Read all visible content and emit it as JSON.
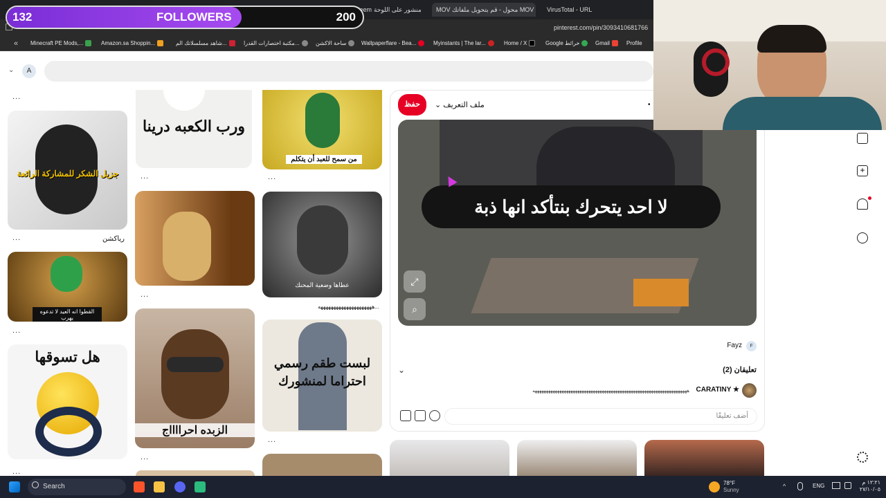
{
  "browser": {
    "tabs": [
      {
        "label": "Meem",
        "active": false
      },
      {
        "label": "منشور على اللوحة",
        "active": false
      },
      {
        "label": "MOV محول - قم بتحويل ملفاتك MOV",
        "active": true
      },
      {
        "label": "VirusTotal - URL",
        "active": false
      }
    ],
    "address": "pinterest.com/pin/3093410681766",
    "bookmarks": [
      {
        "label": "Minecraft PE Mods,...",
        "color": "#3aa04b"
      },
      {
        "label": "Amazon.sa Shoppin...",
        "color": "#f0a020"
      },
      {
        "label": "شاهد مسلسلاتك الم...",
        "color": "#c23"
      },
      {
        "label": "مكتبة اختصارات القدرا...",
        "color": "#888"
      },
      {
        "label": "ساحة الاكشن",
        "color": "#888"
      },
      {
        "label": "Wallpaperflare - Bea...",
        "color": "#e60023"
      },
      {
        "label": "Myinstants | The lar...",
        "color": "#c22"
      },
      {
        "label": "Home / X",
        "color": "#000"
      },
      {
        "label": "Google خرائط",
        "color": "#34a853"
      },
      {
        "label": "Gmail",
        "color": "#ea4335"
      },
      {
        "label": "Profile",
        "color": "#e60023"
      }
    ]
  },
  "overlay": {
    "current": "132",
    "label": "FOLLOWERS",
    "goal": "200",
    "progress": 0.66
  },
  "header": {
    "avatar": "A",
    "search_placeholder": ""
  },
  "pins": {
    "col1": [
      {
        "caption_img": "جزيل الشكر للمشاركة الرائعة",
        "title": "رياكشن"
      },
      {
        "caption_img": "القطوا انه العيد لا تدعوه يهرب",
        "title": ""
      },
      {
        "caption_img": "هل تسوقها",
        "title": ""
      }
    ],
    "col2": [
      {
        "caption_img": "ورب الكعبه درينا",
        "title": ""
      },
      {
        "caption_img": "",
        "title": ""
      },
      {
        "caption_img": "الزبده احرااااج",
        "title": ""
      }
    ],
    "col3": [
      {
        "caption_img": "من سمح للعبد أن يتكلم",
        "title": ""
      },
      {
        "caption_img": "عطاها وضعية المحنك",
        "title": "هههههههههههههههههههههه..."
      },
      {
        "caption_img": "لبست طقم رسمي احتراما لمنشورك",
        "title": ""
      }
    ]
  },
  "detail": {
    "save_label": "حفظ",
    "profile_label": "ملف التعريف",
    "image_caption": "لا احد يتحرك بنتأكد انها ذبة",
    "author": "Fayz",
    "author_initial": "F",
    "comments_header": "تعليقان (2)",
    "comment_user": "CARATINY ★",
    "comment_text": "هههههههههههههههههههههههههههههههههههههههههههههههههههههههههههههههههههههه",
    "comment_placeholder": "أضف تعليقًا"
  },
  "taskbar": {
    "search_label": "Search",
    "weather_temp": "78°F",
    "weather_desc": "Sunny",
    "lang": "ENG",
    "time": "١٢:٢١ م",
    "date": "٢٧/١٠/٠٥"
  }
}
